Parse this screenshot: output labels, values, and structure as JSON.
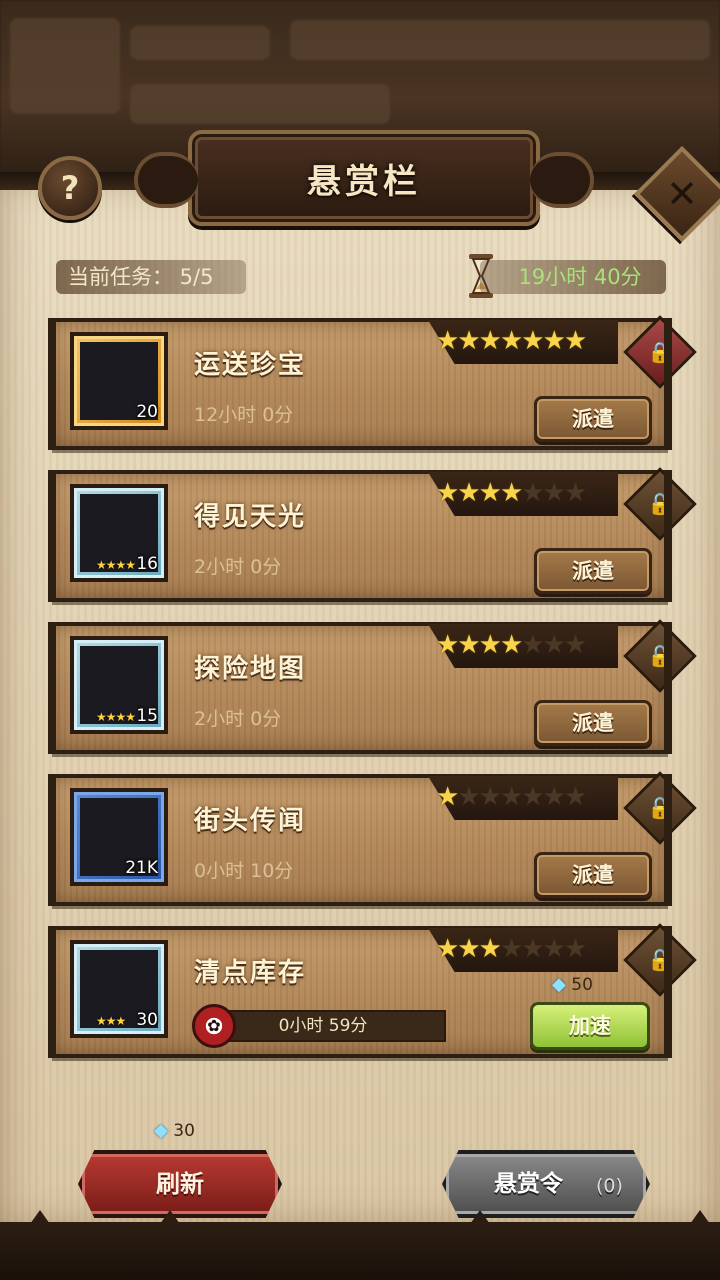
{
  "header": {
    "title": "悬赏栏",
    "help_icon": "question-icon",
    "close_icon": "close-icon",
    "task_count": "当前任务：  5/5",
    "timer": "19小时 40分"
  },
  "tasks": [
    {
      "name": "运送珍宝",
      "duration": "12小时 0分",
      "count": "20",
      "icon_stars": "",
      "stars_on": 7,
      "stars_total": 7,
      "action": "派遣",
      "lock_icon": "lock-icon",
      "frame": "gold"
    },
    {
      "name": "得见天光",
      "duration": "2小时 0分",
      "count": "16",
      "icon_stars": "★★★★",
      "stars_on": 4,
      "stars_total": 7,
      "action": "派遣",
      "lock_icon": "unlock-icon",
      "frame": "teal"
    },
    {
      "name": "探险地图",
      "duration": "2小时 0分",
      "count": "15",
      "icon_stars": "★★★★",
      "stars_on": 4,
      "stars_total": 7,
      "action": "派遣",
      "lock_icon": "unlock-icon",
      "frame": "teal"
    },
    {
      "name": "街头传闻",
      "duration": "0小时 10分",
      "count": "21K",
      "icon_stars": "",
      "stars_on": 1,
      "stars_total": 7,
      "action": "派遣",
      "lock_icon": "unlock-icon",
      "frame": "blue"
    },
    {
      "name": "清点库存",
      "duration": "0小时 59分",
      "count": "30",
      "icon_stars": "★★★",
      "stars_on": 3,
      "stars_total": 7,
      "action": "加速",
      "gem_cost": "50",
      "lock_icon": "unlock-icon",
      "frame": "teal",
      "in_progress": true,
      "progress_fraction": 0.0
    }
  ],
  "footer": {
    "refresh_label": "刷新",
    "refresh_cost": "30",
    "bounty_label": "悬赏令",
    "bounty_count": "(0)"
  }
}
